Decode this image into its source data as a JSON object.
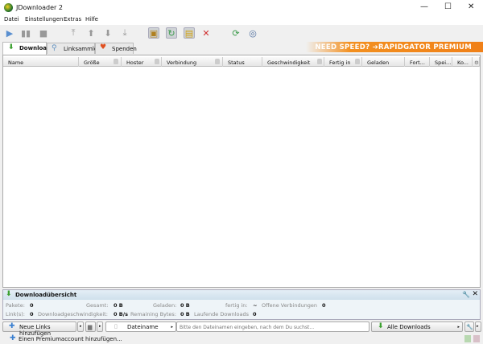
{
  "window": {
    "title": "JDownloader 2",
    "minimize": "—",
    "maximize": "☐",
    "close": "✕"
  },
  "menu": [
    "Datei",
    "Einstellungen",
    "Extras",
    "Hilfe"
  ],
  "toolbar": [
    "play-icon",
    "pause-icon",
    "stop-icon",
    "move-top-icon",
    "move-up-icon",
    "move-down-icon",
    "move-bottom-icon",
    "clipboard-observer-icon",
    "auto-reconnect-icon",
    "premium-icon",
    "silent-mode-icon",
    "reconnect-icon",
    "update-icon"
  ],
  "tabs": [
    {
      "label": "Download"
    },
    {
      "label": "Linksammler"
    },
    {
      "label": "Spenden"
    }
  ],
  "banner": "NEED SPEED? ➔RAPIDGATOR PREMIUM",
  "columns": [
    "Name",
    "Größe",
    "Hoster",
    "Verbindung",
    "Status",
    "Geschwindigkeit",
    "Fertig in",
    "Geladen",
    "Fort...",
    "Spei...",
    "Ko..."
  ],
  "overview": {
    "title": "Downloadübersicht",
    "row1": [
      {
        "label": "Pakete:",
        "value": "0"
      },
      {
        "label": "Gesamt:",
        "value": "0 B"
      },
      {
        "label": "Geladen:",
        "value": "0 B"
      },
      {
        "label": "fertig in:",
        "value": "~"
      },
      {
        "label": "Offene Verbindungen",
        "value": "0"
      }
    ],
    "row2": [
      {
        "label": "Link(s):",
        "value": "0"
      },
      {
        "label": "Downloadgeschwindigkeit:",
        "value": "0 B/s"
      },
      {
        "label": "Remaining Bytes:",
        "value": "0 B"
      },
      {
        "label": "Laufende Downloads",
        "value": "0"
      }
    ]
  },
  "bottom": {
    "add_links": "Neue Links hinzufügen",
    "search_type": "Dateiname",
    "search_placeholder": "Bitte den Dateinamen eingeben, nach dem Du suchst...",
    "filter": "Alle Downloads"
  },
  "status": {
    "premium": "Einen Premiumaccount hinzufügen..."
  }
}
